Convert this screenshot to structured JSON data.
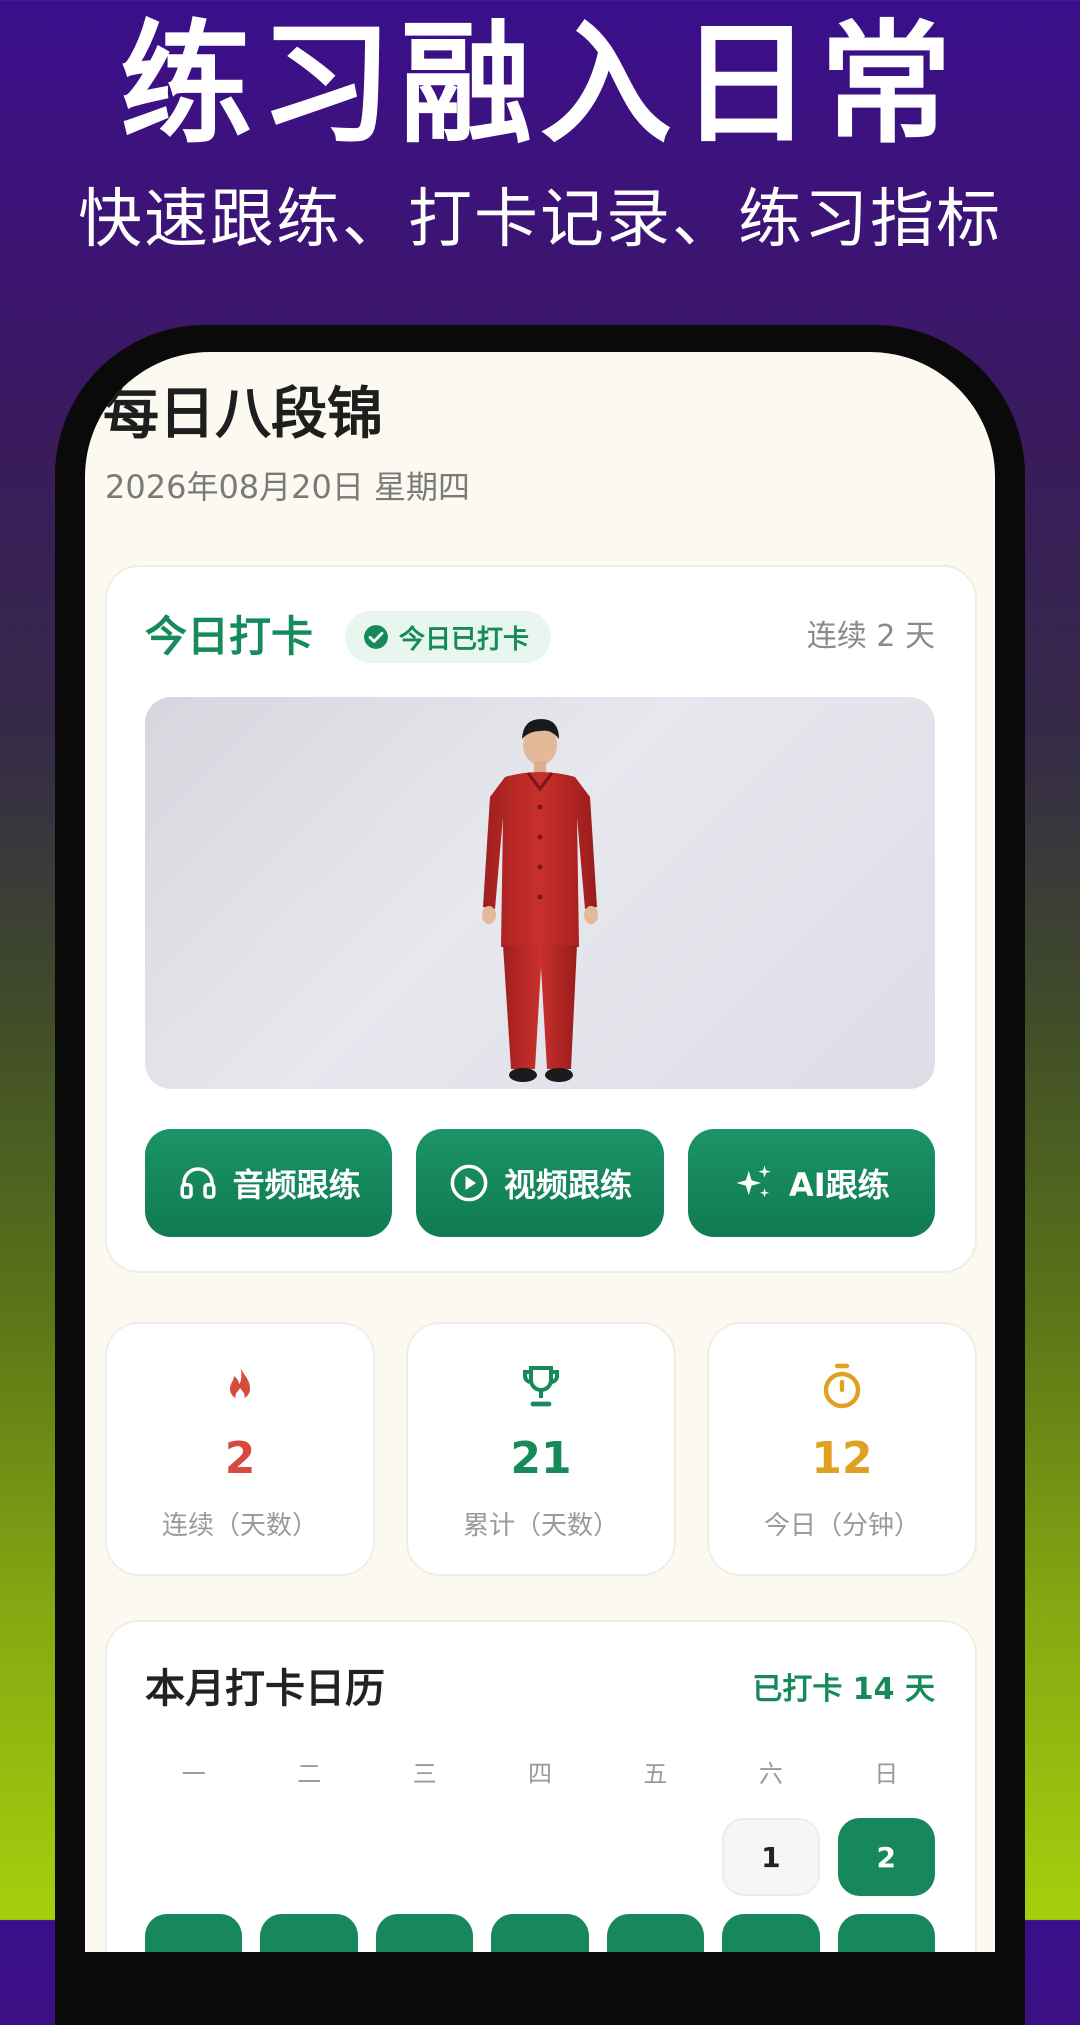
{
  "banner": {
    "title": "练习融入日常",
    "subtitle": "快速跟练、打卡记录、练习指标"
  },
  "app": {
    "title": "每日八段锦",
    "date": "2026年08月20日 星期四"
  },
  "checkin": {
    "title": "今日打卡",
    "badge": "今日已打卡",
    "streak": "连续 2 天",
    "hero_image": "person-in-red-tang-suit",
    "actions": [
      {
        "label": "音频跟练",
        "icon": "headphones-icon"
      },
      {
        "label": "视频跟练",
        "icon": "play-circle-icon"
      },
      {
        "label": "AI跟练",
        "icon": "sparkles-icon"
      }
    ]
  },
  "stats": [
    {
      "value": "2",
      "label": "连续（天数）",
      "icon": "fire-icon",
      "color": "#d64a3f"
    },
    {
      "value": "21",
      "label": "累计（天数）",
      "icon": "trophy-icon",
      "color": "#178a5c"
    },
    {
      "value": "12",
      "label": "今日（分钟）",
      "icon": "timer-icon",
      "color": "#e0a020"
    }
  ],
  "calendar": {
    "title": "本月打卡日历",
    "checked_summary": "已打卡 14 天",
    "weekdays": [
      "一",
      "二",
      "三",
      "四",
      "五",
      "六",
      "日"
    ],
    "first_row_days": [
      {
        "day": "1",
        "checked": false
      },
      {
        "day": "2",
        "checked": true
      }
    ]
  },
  "colors": {
    "accent": "#178a5c",
    "background": "#fbf9f0"
  }
}
